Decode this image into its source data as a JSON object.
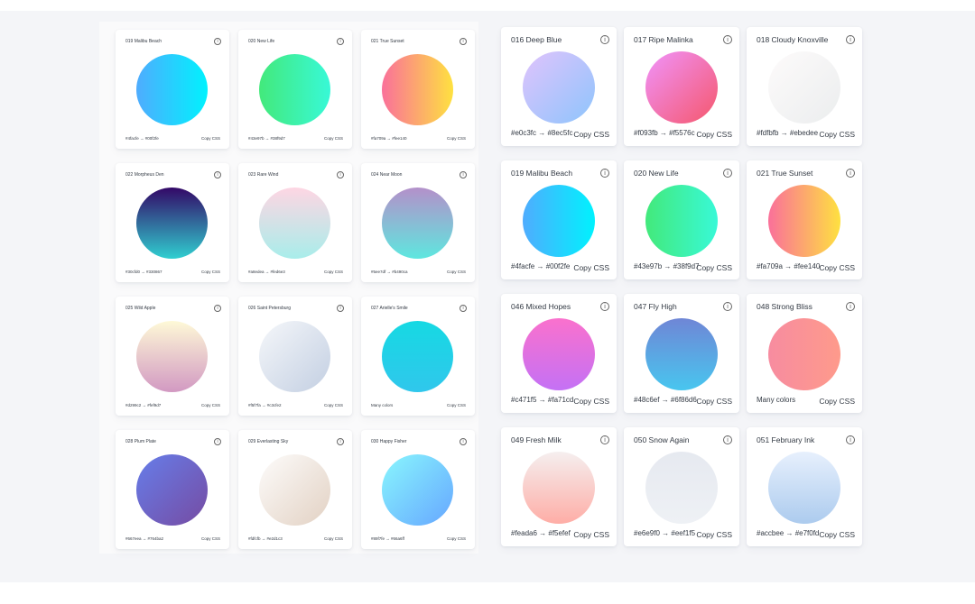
{
  "left_cards": [
    {
      "title": "019 Malibu Beach",
      "hex_text": "#4facfe → #00f2fe",
      "copy_label": "Copy CSS",
      "c1": "#4facfe",
      "c2": "#00f2fe",
      "dir": "to right"
    },
    {
      "title": "020 New Life",
      "hex_text": "#43e97b → #38f9d7",
      "copy_label": "Copy CSS",
      "c1": "#43e97b",
      "c2": "#38f9d7",
      "dir": "to right"
    },
    {
      "title": "021 True Sunset",
      "hex_text": "#fa709a → #fee140",
      "copy_label": "Copy CSS",
      "c1": "#fa709a",
      "c2": "#fee140",
      "dir": "to right"
    },
    {
      "title": "022 Morpheus Den",
      "hex_text": "#30cfd0 → #330867",
      "copy_label": "Copy CSS",
      "c1": "#330867",
      "c2": "#30cfd0",
      "dir": "to bottom"
    },
    {
      "title": "023 Rare Wind",
      "hex_text": "#a8edea → #fed6e3",
      "copy_label": "Copy CSS",
      "c1": "#fed6e3",
      "c2": "#a8edea",
      "dir": "to bottom"
    },
    {
      "title": "024 Near Moon",
      "hex_text": "#5ee7df → #b490ca",
      "copy_label": "Copy CSS",
      "c1": "#b490ca",
      "c2": "#5ee7df",
      "dir": "to bottom"
    },
    {
      "title": "025 Wild Apple",
      "hex_text": "#d299c2 → #fef9d7",
      "copy_label": "Copy CSS",
      "c1": "#fef9d7",
      "c2": "#d299c2",
      "dir": "to bottom"
    },
    {
      "title": "026 Saint Petersburg",
      "hex_text": "#f5f7fa → #c3cfe2",
      "copy_label": "Copy CSS",
      "c1": "#f5f7fa",
      "c2": "#c3cfe2",
      "dir": "135deg"
    },
    {
      "title": "027 Arielle's Smile",
      "hex_text": "Many colors",
      "copy_label": "Copy CSS",
      "c1": "#16d9e3",
      "c2": "#30c7ec",
      "dir": "to bottom"
    },
    {
      "title": "028 Plum Plate",
      "hex_text": "#667eea → #764ba2",
      "copy_label": "Copy CSS",
      "c1": "#667eea",
      "c2": "#764ba2",
      "dir": "135deg"
    },
    {
      "title": "029 Everlasting Sky",
      "hex_text": "#fdfcfb → #e2d1c3",
      "copy_label": "Copy CSS",
      "c1": "#fdfcfb",
      "c2": "#e2d1c3",
      "dir": "135deg"
    },
    {
      "title": "030 Happy Fisher",
      "hex_text": "#89f7fe → #66a6ff",
      "copy_label": "Copy CSS",
      "c1": "#89f7fe",
      "c2": "#66a6ff",
      "dir": "135deg"
    }
  ],
  "right_cards": [
    {
      "title": "016 Deep Blue",
      "hex_text": "#e0c3fc → #8ec5fc",
      "copy_label": "Copy CSS",
      "c1": "#e0c3fc",
      "c2": "#8ec5fc",
      "dir": "135deg"
    },
    {
      "title": "017 Ripe Malinka",
      "hex_text": "#f093fb → #f5576c",
      "copy_label": "Copy CSS",
      "c1": "#f093fb",
      "c2": "#f5576c",
      "dir": "135deg"
    },
    {
      "title": "018 Cloudy Knoxville",
      "hex_text": "#fdfbfb → #ebedee",
      "copy_label": "Copy CSS",
      "c1": "#fdfbfb",
      "c2": "#ebedee",
      "dir": "135deg"
    },
    {
      "title": "019 Malibu Beach",
      "hex_text": "#4facfe → #00f2fe",
      "copy_label": "Copy CSS",
      "c1": "#4facfe",
      "c2": "#00f2fe",
      "dir": "to right"
    },
    {
      "title": "020 New Life",
      "hex_text": "#43e97b → #38f9d7",
      "copy_label": "Copy CSS",
      "c1": "#43e97b",
      "c2": "#38f9d7",
      "dir": "to right"
    },
    {
      "title": "021 True Sunset",
      "hex_text": "#fa709a → #fee140",
      "copy_label": "Copy CSS",
      "c1": "#fa709a",
      "c2": "#fee140",
      "dir": "to right"
    },
    {
      "title": "046 Mixed Hopes",
      "hex_text": "#c471f5 → #fa71cd",
      "copy_label": "Copy CSS",
      "c1": "#fa71cd",
      "c2": "#c471f5",
      "dir": "to bottom"
    },
    {
      "title": "047 Fly High",
      "hex_text": "#48c6ef → #6f86d6",
      "copy_label": "Copy CSS",
      "c1": "#6f86d6",
      "c2": "#48c6ef",
      "dir": "to bottom"
    },
    {
      "title": "048 Strong Bliss",
      "hex_text": "Many colors",
      "copy_label": "Copy CSS",
      "c1": "#f78ca0",
      "c2": "#fe9a8b",
      "dir": "to right"
    },
    {
      "title": "049 Fresh Milk",
      "hex_text": "#feada6 → #f5efef",
      "copy_label": "Copy CSS",
      "c1": "#f5efef",
      "c2": "#feada6",
      "dir": "to bottom"
    },
    {
      "title": "050 Snow Again",
      "hex_text": "#e6e9f0 → #eef1f5",
      "copy_label": "Copy CSS",
      "c1": "#e6e9f0",
      "c2": "#eef1f5",
      "dir": "to bottom"
    },
    {
      "title": "051 February Ink",
      "hex_text": "#accbee → #e7f0fd",
      "copy_label": "Copy CSS",
      "c1": "#e7f0fd",
      "c2": "#accbee",
      "dir": "to bottom"
    }
  ],
  "icons": {
    "info": "info-circle-icon",
    "glyph": "i"
  }
}
